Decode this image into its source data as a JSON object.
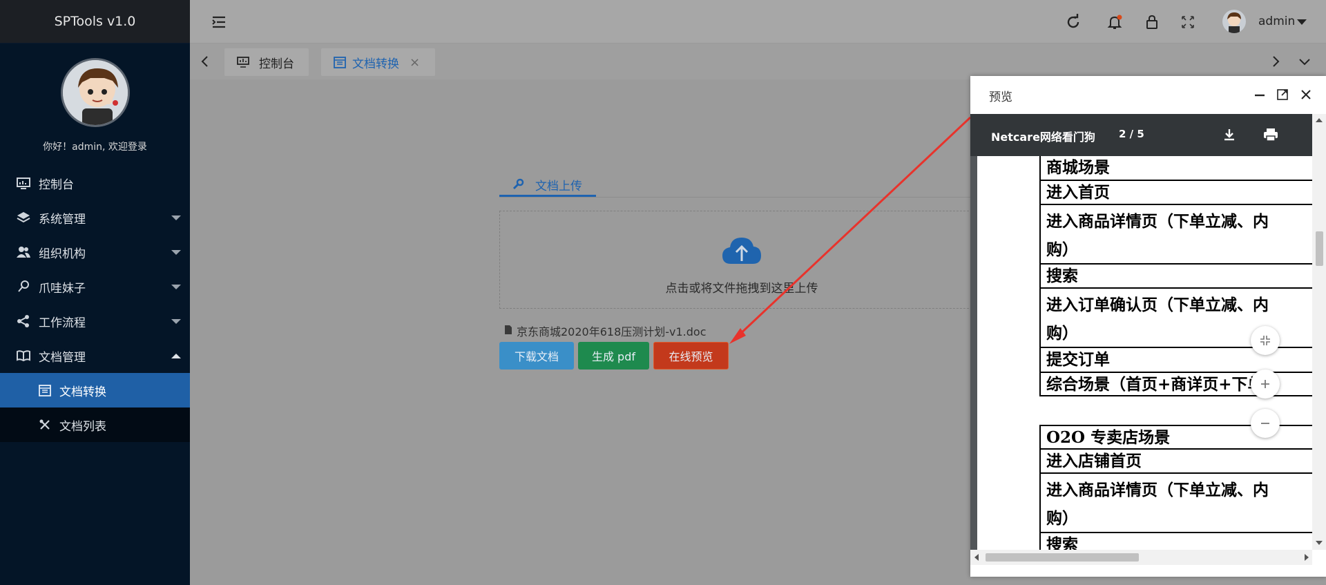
{
  "app": {
    "title": "SPTools v1.0"
  },
  "sidebar": {
    "greeting": "你好！admin, 欢迎登录",
    "items": [
      {
        "label": "控制台",
        "icon": "dashboard-icon"
      },
      {
        "label": "系统管理",
        "icon": "layers-icon"
      },
      {
        "label": "组织机构",
        "icon": "users-icon"
      },
      {
        "label": "爪哇妹子",
        "icon": "pin-icon"
      },
      {
        "label": "工作流程",
        "icon": "share-icon"
      },
      {
        "label": "文档管理",
        "icon": "book-icon"
      }
    ],
    "subitems": [
      {
        "label": "文档转换",
        "icon": "calendar-icon"
      },
      {
        "label": "文档列表",
        "icon": "tools-icon"
      }
    ]
  },
  "header": {
    "user": "admin"
  },
  "tabs": [
    {
      "label": "控制台",
      "icon": "monitor-icon"
    },
    {
      "label": "文档转换",
      "icon": "calendar-icon",
      "close": "×"
    }
  ],
  "content": {
    "upload_tab": "文档上传",
    "drop_text": "点击或将文件拖拽到这里上传",
    "filename": "京东商城2020年618压测计划-v1.doc",
    "buttons": {
      "download": "下载文档",
      "pdf": "生成 pdf",
      "preview": "在线预览"
    }
  },
  "preview": {
    "title": "预览",
    "doc_name": "Netcare网络看门狗",
    "page_indicator": "2 / 5",
    "rows": [
      "商城场景",
      "进入首页",
      "进入商品详情页（下单立减、内",
      "购）",
      "搜索",
      "进入订单确认页（下单立减、内",
      "购）",
      "提交订单",
      "综合场景（首页+商详页+下单）",
      "O2O 专卖店场景",
      "进入店铺首页",
      "进入商品详情页（下单立减、内",
      "购）",
      "搜索"
    ]
  },
  "colors": {
    "sidebar_bg": "#041527",
    "active_menu": "#1f60a6",
    "btn_download": "#3a8fc8",
    "btn_pdf": "#1e8a4e",
    "btn_preview": "#c3391c",
    "arrow": "#e8332c"
  }
}
